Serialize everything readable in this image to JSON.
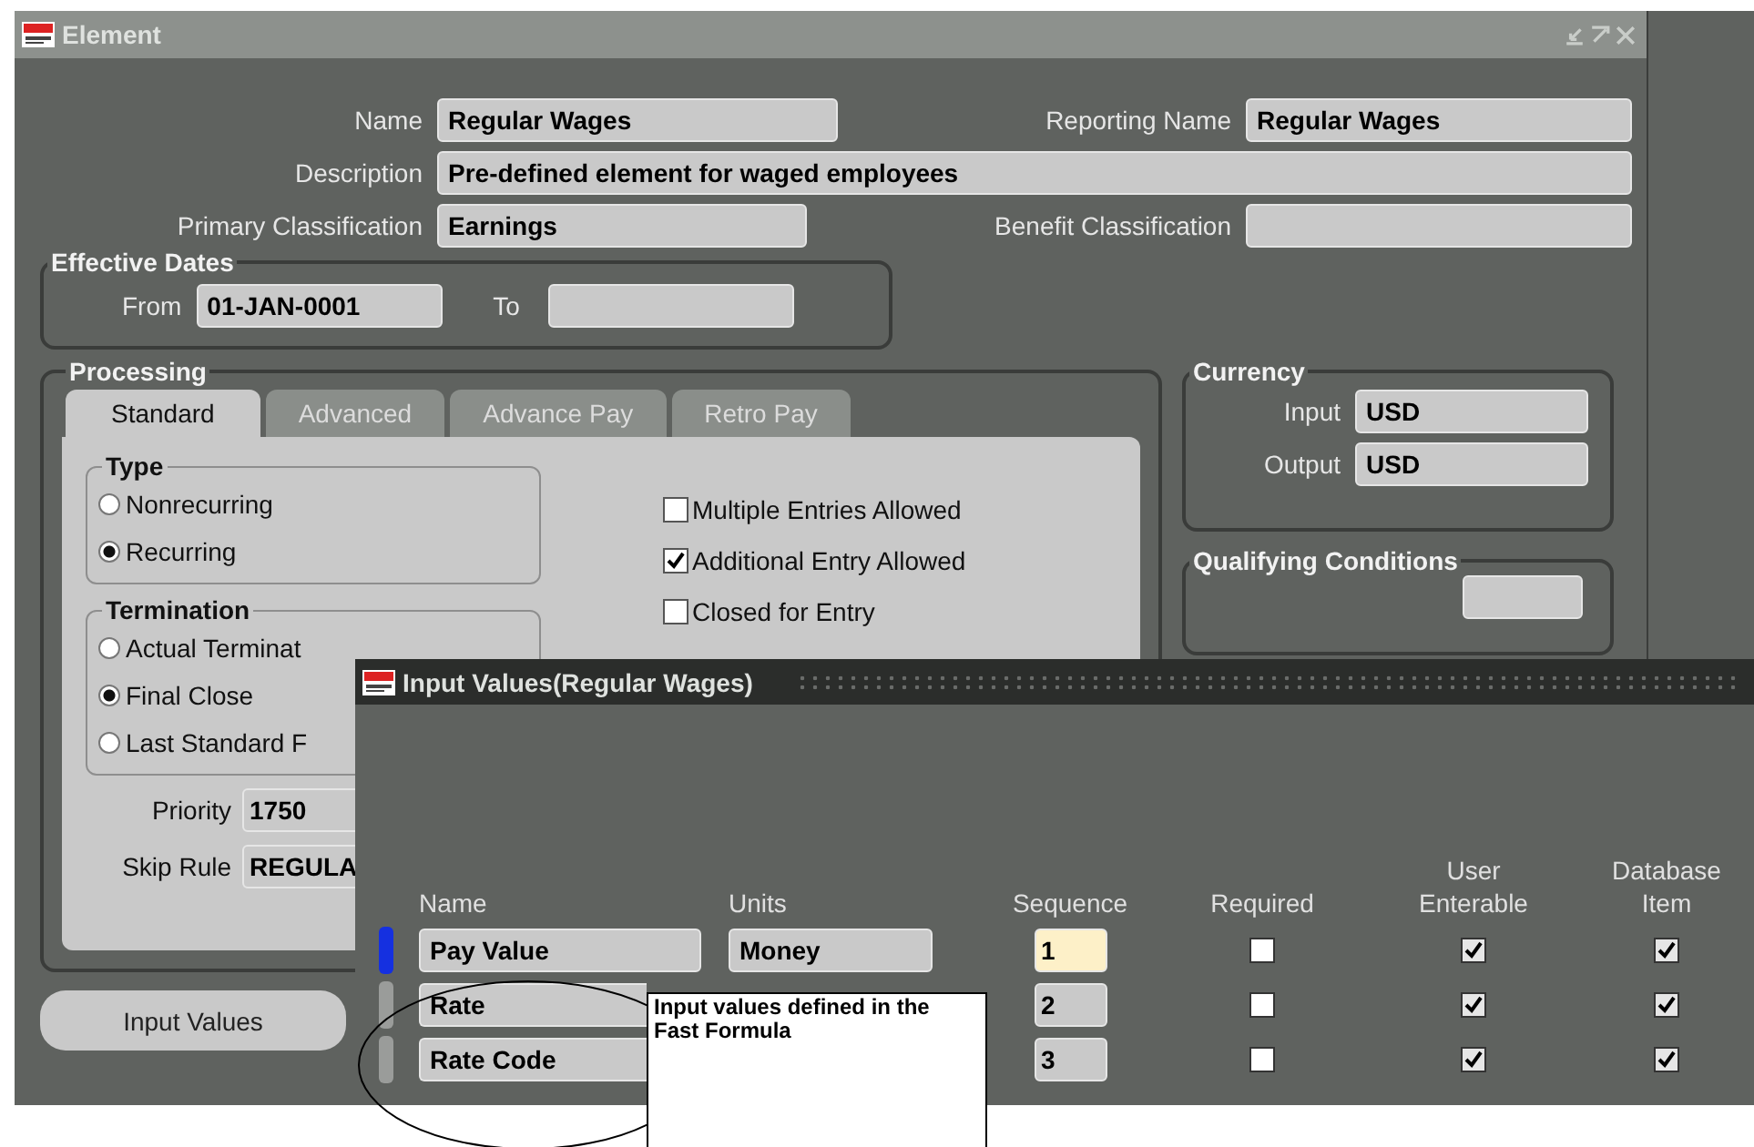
{
  "element_window": {
    "title": "Element",
    "name": {
      "label": "Name",
      "value": "Regular Wages"
    },
    "reporting_name": {
      "label": "Reporting Name",
      "value": "Regular Wages"
    },
    "description": {
      "label": "Description",
      "value": "Pre-defined element for waged employees"
    },
    "primary_classification": {
      "label": "Primary Classification",
      "value": "Earnings"
    },
    "benefit_classification": {
      "label": "Benefit Classification"
    },
    "effective_dates": {
      "title": "Effective Dates",
      "from": {
        "label": "From",
        "value": "01-JAN-0001"
      },
      "to": {
        "label": "To"
      }
    },
    "processing": {
      "title": "Processing",
      "tabs": [
        {
          "label": "Standard",
          "selected": true
        },
        {
          "label": "Advanced",
          "selected": false
        },
        {
          "label": "Advance Pay",
          "selected": false
        },
        {
          "label": "Retro Pay",
          "selected": false
        }
      ],
      "type": {
        "title": "Type",
        "options": [
          {
            "label": "Nonrecurring",
            "selected": false
          },
          {
            "label": "Recurring",
            "selected": true
          }
        ]
      },
      "termination": {
        "title": "Termination",
        "options": [
          {
            "label": "Actual Terminat",
            "selected": false
          },
          {
            "label": "Final Close",
            "selected": true
          },
          {
            "label": "Last Standard F",
            "selected": false
          }
        ]
      },
      "options": [
        {
          "label": "Multiple Entries Allowed",
          "checked": false
        },
        {
          "label": "Additional Entry Allowed",
          "checked": true
        },
        {
          "label": "Closed for Entry",
          "checked": false
        }
      ],
      "priority": {
        "label": "Priority",
        "value": "1750"
      },
      "skip_rule": {
        "label": "Skip Rule",
        "value": "REGULA"
      }
    },
    "currency": {
      "title": "Currency",
      "input": {
        "label": "Input",
        "value": "USD"
      },
      "output": {
        "label": "Output",
        "value": "USD"
      }
    },
    "qualifying_conditions": {
      "title": "Qualifying Conditions"
    },
    "buttons": [
      "Input Values"
    ]
  },
  "input_values_window": {
    "title": "Input Values(Regular Wages)",
    "columns": [
      "Name",
      "Units",
      "Sequence",
      "Required",
      "User Enterable",
      "Database Item"
    ],
    "rows": [
      {
        "name": "Pay Value",
        "units": "Money",
        "sequence": "1",
        "selected": true,
        "required": false,
        "user_enterable": true,
        "database_item": true
      },
      {
        "name": "Rate",
        "sequence": "2",
        "selected": false,
        "required": false,
        "user_enterable": true,
        "database_item": true
      },
      {
        "name": "Rate Code",
        "sequence": "3",
        "selected": false,
        "required": false,
        "user_enterable": true,
        "database_item": true
      }
    ]
  },
  "callout": {
    "text": "Input values defined in the Fast Formula"
  }
}
